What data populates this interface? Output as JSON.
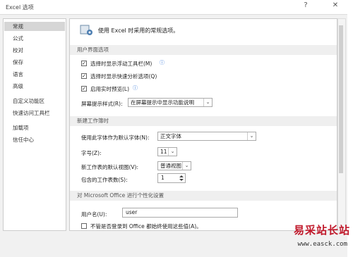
{
  "window": {
    "title": "Excel 选项",
    "help_label": "?",
    "close_label": "✕"
  },
  "nav": {
    "items": [
      "常规",
      "公式",
      "校对",
      "保存",
      "语言",
      "高级",
      "自定义功能区",
      "快速访问工具栏",
      "加载项",
      "信任中心"
    ],
    "selected_index": 0
  },
  "header": {
    "text": "使用 Excel 时采用的常规选项。"
  },
  "ui_options": {
    "section": "用户界面选项",
    "mini_toolbar": {
      "label": "选择时显示浮动工具栏(M)",
      "checked": true
    },
    "quick_analysis": {
      "label": "选择时显示快速分析选项(Q)",
      "checked": true
    },
    "live_preview": {
      "label": "启用实时预览(L)",
      "checked": true
    },
    "screentip": {
      "label": "屏幕提示样式(R):",
      "value": "在屏幕提示中显示功能说明"
    }
  },
  "new_workbook": {
    "section": "新建工作簿时",
    "font": {
      "label": "使用此字体作为默认字体(N):",
      "value": "正文字体"
    },
    "size": {
      "label": "字号(Z):",
      "value": "11"
    },
    "view": {
      "label": "新工作表的默认视图(V):",
      "value": "普通视图"
    },
    "sheets": {
      "label": "包含的工作表数(S):",
      "value": "1"
    }
  },
  "personalize": {
    "section": "对 Microsoft Office 进行个性化设置",
    "username": {
      "label": "用户名(U):",
      "value": "user"
    },
    "always_use": {
      "label": "不管是否登录到 Office 都始终使用这些值(A)。",
      "checked": false
    }
  },
  "watermark": {
    "text": "易采站长站",
    "url": "www.easck.com"
  }
}
